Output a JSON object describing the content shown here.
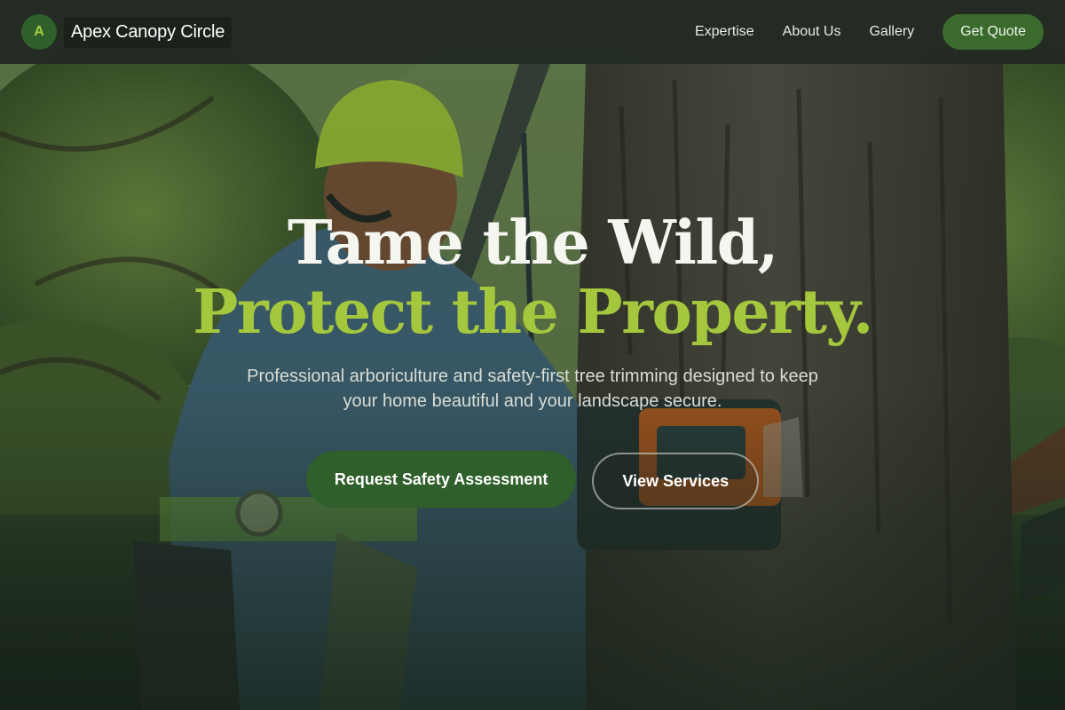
{
  "brand": {
    "badge_letter": "A",
    "name": "Apex Canopy Circle"
  },
  "nav": {
    "links": [
      "Expertise",
      "About Us",
      "Gallery"
    ],
    "cta_label": "Get Quote"
  },
  "hero": {
    "headline_line1": "Tame the Wild,",
    "headline_line2": "Protect the Property.",
    "subtitle": "Professional arboriculture and safety-first tree trimming designed to keep your home beautiful and your landscape secure.",
    "primary_button": "Request Safety Assessment",
    "secondary_button": "View Services"
  },
  "colors": {
    "accent_green": "#a4c73d",
    "button_green": "#2f5f2a",
    "navbar_bg": "#212822"
  },
  "background_image": "arborist-with-chainsaw-photo"
}
